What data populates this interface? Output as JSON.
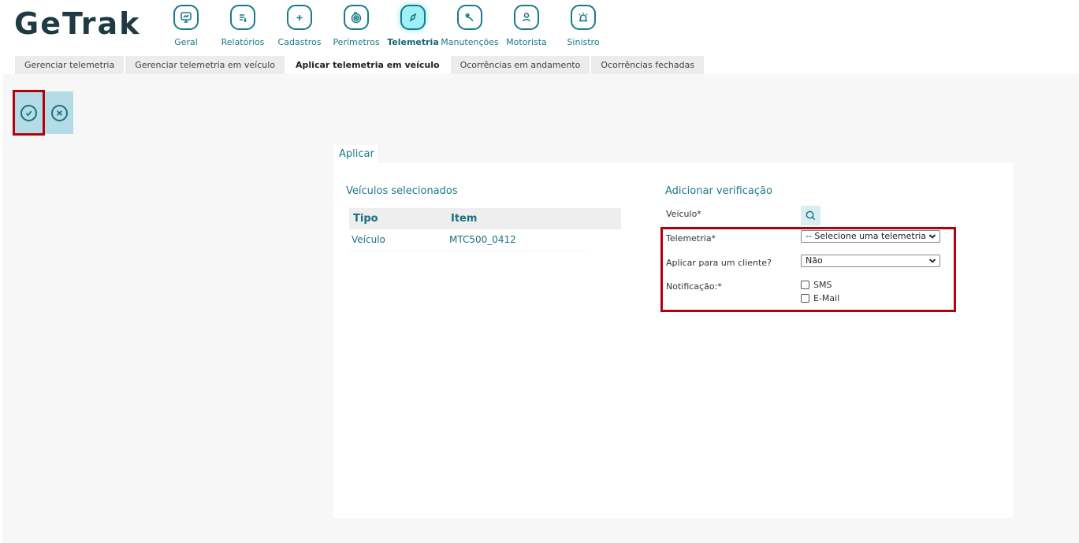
{
  "app": {
    "logo": "GeTrak"
  },
  "nav": [
    {
      "label": "Geral",
      "icon": "monitor-chart-icon"
    },
    {
      "label": "Relatórios",
      "icon": "report-icon"
    },
    {
      "label": "Cadastros",
      "icon": "folder-plus-icon"
    },
    {
      "label": "Perímetros",
      "icon": "perimeter-icon"
    },
    {
      "label": "Telemetria",
      "icon": "compass-icon",
      "active": true
    },
    {
      "label": "Manutenções",
      "icon": "wrench-icon"
    },
    {
      "label": "Motorista",
      "icon": "driver-icon"
    },
    {
      "label": "Sinistro",
      "icon": "alarm-icon"
    }
  ],
  "tabs": [
    {
      "label": "Gerenciar telemetria"
    },
    {
      "label": "Gerenciar telemetria em veículo"
    },
    {
      "label": "Aplicar telemetria em veículo",
      "active": true
    },
    {
      "label": "Ocorrências em andamento"
    },
    {
      "label": "Ocorrências fechadas"
    }
  ],
  "toolbar": {
    "confirm_icon": "check-circle-icon",
    "cancel_icon": "x-circle-icon"
  },
  "panel": {
    "tab_label": "Aplicar",
    "left": {
      "title": "Veículos selecionados",
      "columns": [
        "Tipo",
        "Item"
      ],
      "rows": [
        {
          "tipo": "Veículo",
          "item": "MTC500_0412"
        }
      ]
    },
    "right": {
      "title": "Adicionar verificação",
      "veiculo_label": "Veículo*",
      "telemetria_label": "Telemetria*",
      "telemetria_value": "-- Selecione uma telemetria --",
      "cliente_label": "Aplicar para um cliente?",
      "cliente_value": "Não",
      "notificacao_label": "Notificação:*",
      "notificacao_options": [
        "SMS",
        "E-Mail"
      ]
    }
  },
  "colors": {
    "accent": "#1a7a8c",
    "highlight": "#b3000b",
    "button_bg": "#b4dce6"
  }
}
